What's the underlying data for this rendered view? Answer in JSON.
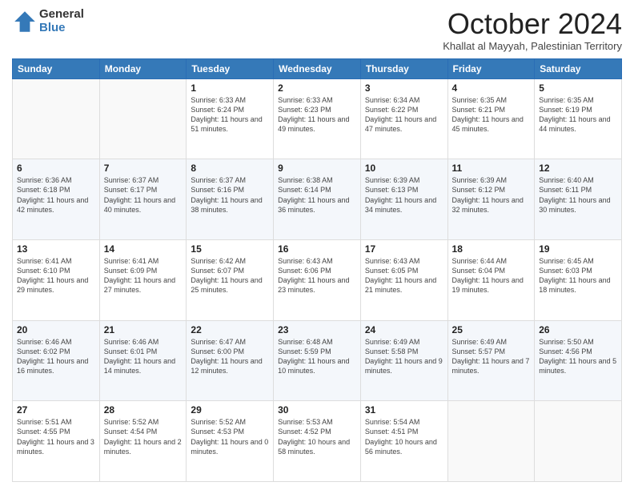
{
  "header": {
    "logo_line1": "General",
    "logo_line2": "Blue",
    "month_title": "October 2024",
    "subtitle": "Khallat al Mayyah, Palestinian Territory"
  },
  "weekdays": [
    "Sunday",
    "Monday",
    "Tuesday",
    "Wednesday",
    "Thursday",
    "Friday",
    "Saturday"
  ],
  "weeks": [
    [
      {
        "day": "",
        "info": ""
      },
      {
        "day": "",
        "info": ""
      },
      {
        "day": "1",
        "info": "Sunrise: 6:33 AM\nSunset: 6:24 PM\nDaylight: 11 hours and 51 minutes."
      },
      {
        "day": "2",
        "info": "Sunrise: 6:33 AM\nSunset: 6:23 PM\nDaylight: 11 hours and 49 minutes."
      },
      {
        "day": "3",
        "info": "Sunrise: 6:34 AM\nSunset: 6:22 PM\nDaylight: 11 hours and 47 minutes."
      },
      {
        "day": "4",
        "info": "Sunrise: 6:35 AM\nSunset: 6:21 PM\nDaylight: 11 hours and 45 minutes."
      },
      {
        "day": "5",
        "info": "Sunrise: 6:35 AM\nSunset: 6:19 PM\nDaylight: 11 hours and 44 minutes."
      }
    ],
    [
      {
        "day": "6",
        "info": "Sunrise: 6:36 AM\nSunset: 6:18 PM\nDaylight: 11 hours and 42 minutes."
      },
      {
        "day": "7",
        "info": "Sunrise: 6:37 AM\nSunset: 6:17 PM\nDaylight: 11 hours and 40 minutes."
      },
      {
        "day": "8",
        "info": "Sunrise: 6:37 AM\nSunset: 6:16 PM\nDaylight: 11 hours and 38 minutes."
      },
      {
        "day": "9",
        "info": "Sunrise: 6:38 AM\nSunset: 6:14 PM\nDaylight: 11 hours and 36 minutes."
      },
      {
        "day": "10",
        "info": "Sunrise: 6:39 AM\nSunset: 6:13 PM\nDaylight: 11 hours and 34 minutes."
      },
      {
        "day": "11",
        "info": "Sunrise: 6:39 AM\nSunset: 6:12 PM\nDaylight: 11 hours and 32 minutes."
      },
      {
        "day": "12",
        "info": "Sunrise: 6:40 AM\nSunset: 6:11 PM\nDaylight: 11 hours and 30 minutes."
      }
    ],
    [
      {
        "day": "13",
        "info": "Sunrise: 6:41 AM\nSunset: 6:10 PM\nDaylight: 11 hours and 29 minutes."
      },
      {
        "day": "14",
        "info": "Sunrise: 6:41 AM\nSunset: 6:09 PM\nDaylight: 11 hours and 27 minutes."
      },
      {
        "day": "15",
        "info": "Sunrise: 6:42 AM\nSunset: 6:07 PM\nDaylight: 11 hours and 25 minutes."
      },
      {
        "day": "16",
        "info": "Sunrise: 6:43 AM\nSunset: 6:06 PM\nDaylight: 11 hours and 23 minutes."
      },
      {
        "day": "17",
        "info": "Sunrise: 6:43 AM\nSunset: 6:05 PM\nDaylight: 11 hours and 21 minutes."
      },
      {
        "day": "18",
        "info": "Sunrise: 6:44 AM\nSunset: 6:04 PM\nDaylight: 11 hours and 19 minutes."
      },
      {
        "day": "19",
        "info": "Sunrise: 6:45 AM\nSunset: 6:03 PM\nDaylight: 11 hours and 18 minutes."
      }
    ],
    [
      {
        "day": "20",
        "info": "Sunrise: 6:46 AM\nSunset: 6:02 PM\nDaylight: 11 hours and 16 minutes."
      },
      {
        "day": "21",
        "info": "Sunrise: 6:46 AM\nSunset: 6:01 PM\nDaylight: 11 hours and 14 minutes."
      },
      {
        "day": "22",
        "info": "Sunrise: 6:47 AM\nSunset: 6:00 PM\nDaylight: 11 hours and 12 minutes."
      },
      {
        "day": "23",
        "info": "Sunrise: 6:48 AM\nSunset: 5:59 PM\nDaylight: 11 hours and 10 minutes."
      },
      {
        "day": "24",
        "info": "Sunrise: 6:49 AM\nSunset: 5:58 PM\nDaylight: 11 hours and 9 minutes."
      },
      {
        "day": "25",
        "info": "Sunrise: 6:49 AM\nSunset: 5:57 PM\nDaylight: 11 hours and 7 minutes."
      },
      {
        "day": "26",
        "info": "Sunrise: 5:50 AM\nSunset: 4:56 PM\nDaylight: 11 hours and 5 minutes."
      }
    ],
    [
      {
        "day": "27",
        "info": "Sunrise: 5:51 AM\nSunset: 4:55 PM\nDaylight: 11 hours and 3 minutes."
      },
      {
        "day": "28",
        "info": "Sunrise: 5:52 AM\nSunset: 4:54 PM\nDaylight: 11 hours and 2 minutes."
      },
      {
        "day": "29",
        "info": "Sunrise: 5:52 AM\nSunset: 4:53 PM\nDaylight: 11 hours and 0 minutes."
      },
      {
        "day": "30",
        "info": "Sunrise: 5:53 AM\nSunset: 4:52 PM\nDaylight: 10 hours and 58 minutes."
      },
      {
        "day": "31",
        "info": "Sunrise: 5:54 AM\nSunset: 4:51 PM\nDaylight: 10 hours and 56 minutes."
      },
      {
        "day": "",
        "info": ""
      },
      {
        "day": "",
        "info": ""
      }
    ]
  ]
}
